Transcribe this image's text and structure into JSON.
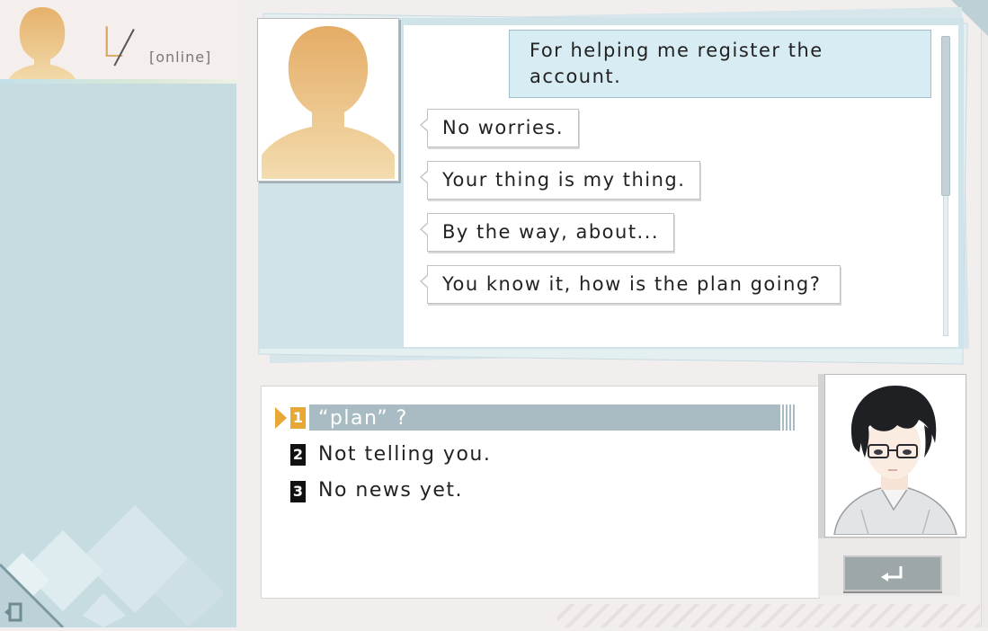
{
  "contact": {
    "initial": "L",
    "status": "[online]"
  },
  "messages": [
    {
      "from": "me",
      "text": "For helping me register the account."
    },
    {
      "from": "partner",
      "text": "No worries."
    },
    {
      "from": "partner",
      "text": "Your thing is my thing."
    },
    {
      "from": "partner",
      "text": "By the way, about..."
    },
    {
      "from": "partner",
      "text": "You know it, how is the plan going?"
    }
  ],
  "choices": [
    {
      "num": "1",
      "text": "“plan” ?",
      "selected": true
    },
    {
      "num": "2",
      "text": "Not telling you.",
      "selected": false
    },
    {
      "num": "3",
      "text": "No news yet.",
      "selected": false
    }
  ],
  "icons": {
    "exit": "exit-door-icon",
    "back": "return-arrow-icon",
    "selector": "play-arrow-icon"
  },
  "colors": {
    "accent": "#e8a835",
    "silhouette": "#e9bc78",
    "selected_row": "#a9bcc3",
    "my_bubble": "#d7ecf3",
    "panel": "#c7dce1"
  }
}
